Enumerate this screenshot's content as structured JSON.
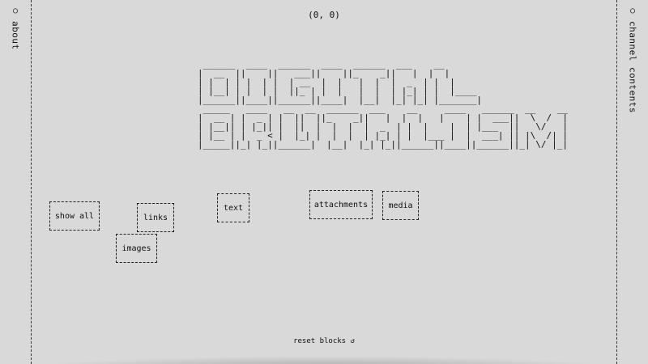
{
  "coords_readout": "(0, 0)",
  "sidebar_left": {
    "icon": "circle-icon",
    "glyph": "○",
    "label": "about"
  },
  "sidebar_right": {
    "icon": "circle-icon",
    "glyph": "○",
    "label": "channel contents"
  },
  "title": "DIGITAL BRUTALISM",
  "blocks": {
    "show_all": "show all",
    "links": "links",
    "images": "images",
    "text": "text",
    "attachments": "attachments",
    "media": "media"
  },
  "reset": {
    "label": "reset blocks",
    "glyph": "↺"
  }
}
